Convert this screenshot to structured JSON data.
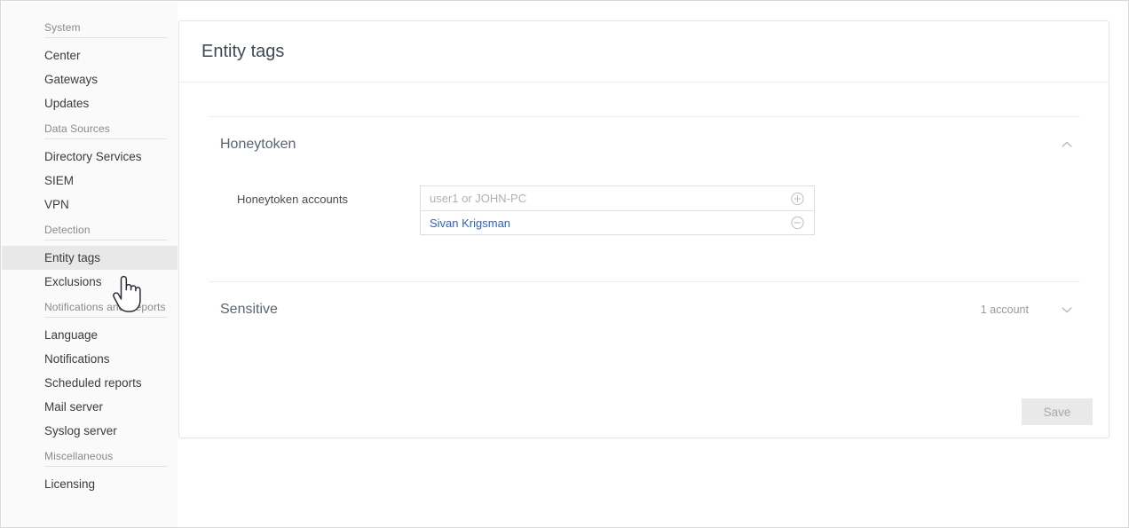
{
  "sidebar": {
    "groups": [
      {
        "header": "System",
        "items": [
          {
            "label": "Center",
            "active": false
          },
          {
            "label": "Gateways",
            "active": false
          },
          {
            "label": "Updates",
            "active": false
          }
        ]
      },
      {
        "header": "Data Sources",
        "items": [
          {
            "label": "Directory Services",
            "active": false
          },
          {
            "label": "SIEM",
            "active": false
          },
          {
            "label": "VPN",
            "active": false
          }
        ]
      },
      {
        "header": "Detection",
        "items": [
          {
            "label": "Entity tags",
            "active": true
          },
          {
            "label": "Exclusions",
            "active": false
          }
        ]
      },
      {
        "header": "Notifications and Reports",
        "items": [
          {
            "label": "Language",
            "active": false
          },
          {
            "label": "Notifications",
            "active": false
          },
          {
            "label": "Scheduled reports",
            "active": false
          },
          {
            "label": "Mail server",
            "active": false
          },
          {
            "label": "Syslog server",
            "active": false
          }
        ]
      },
      {
        "header": "Miscellaneous",
        "items": [
          {
            "label": "Licensing",
            "active": false
          }
        ]
      }
    ]
  },
  "page": {
    "title": "Entity tags"
  },
  "sections": {
    "honeytoken": {
      "title": "Honeytoken",
      "expanded": true,
      "chevron_icon": "chevron-up-icon",
      "field_label": "Honeytoken accounts",
      "input_placeholder": "user1 or JOHN-PC",
      "input_value": "",
      "add_icon": "circle-plus-icon",
      "remove_icon": "circle-minus-icon",
      "accounts": [
        {
          "name": "Sivan Krigsman"
        }
      ]
    },
    "sensitive": {
      "title": "Sensitive",
      "expanded": false,
      "chevron_icon": "chevron-down-icon",
      "meta": "1 account"
    }
  },
  "footer": {
    "save_label": "Save",
    "save_disabled": true
  },
  "colors": {
    "link": "#2a64c8",
    "active_nav_bg": "#e8e8e8",
    "muted_text": "#9a9a9a",
    "save_disabled_bg": "#e9e9e9"
  },
  "cursor": {
    "icon": "pointing-hand-cursor"
  }
}
